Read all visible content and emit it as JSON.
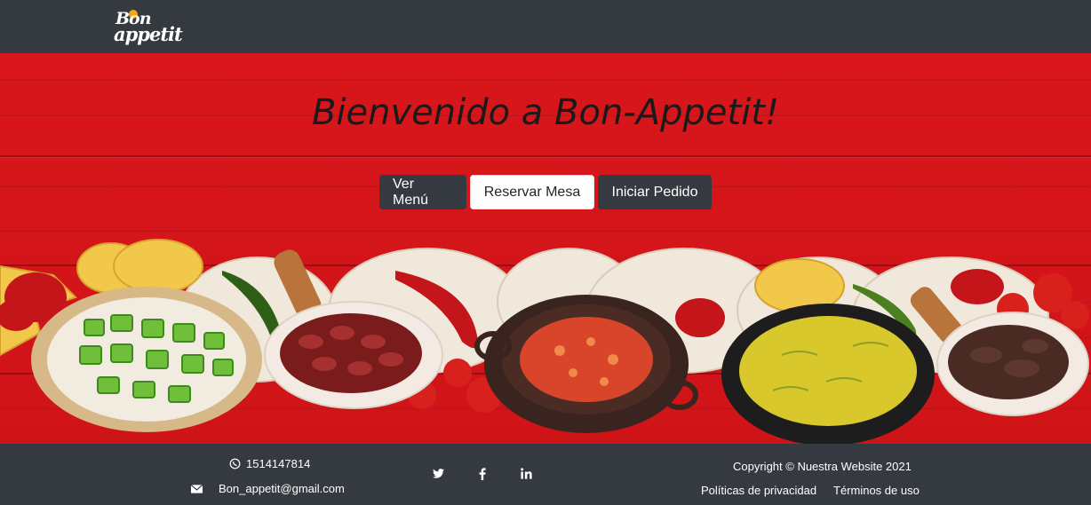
{
  "navbar": {
    "brand": "Bon appetit",
    "brand_line1": "Bon",
    "brand_line2": "appetit"
  },
  "hero": {
    "title": "Bienvenido a Bon-Appetit!",
    "buttons": [
      {
        "label": "Ver Menú",
        "style": "dark"
      },
      {
        "label": "Reservar Mesa",
        "style": "light"
      },
      {
        "label": "Iniciar Pedido",
        "style": "dark"
      }
    ]
  },
  "footer": {
    "phone": "1514147814",
    "email": "Bon_appetit@gmail.com",
    "social": [
      "twitter-icon",
      "facebook-icon",
      "linkedin-icon"
    ],
    "copyright": "Copyright © Nuestra Website 2021",
    "privacy": "Políticas de privacidad",
    "terms": "Términos de uso"
  },
  "colors": {
    "navbar": "#343a40",
    "hero_red": "#d8161c",
    "footer": "#343a40"
  }
}
